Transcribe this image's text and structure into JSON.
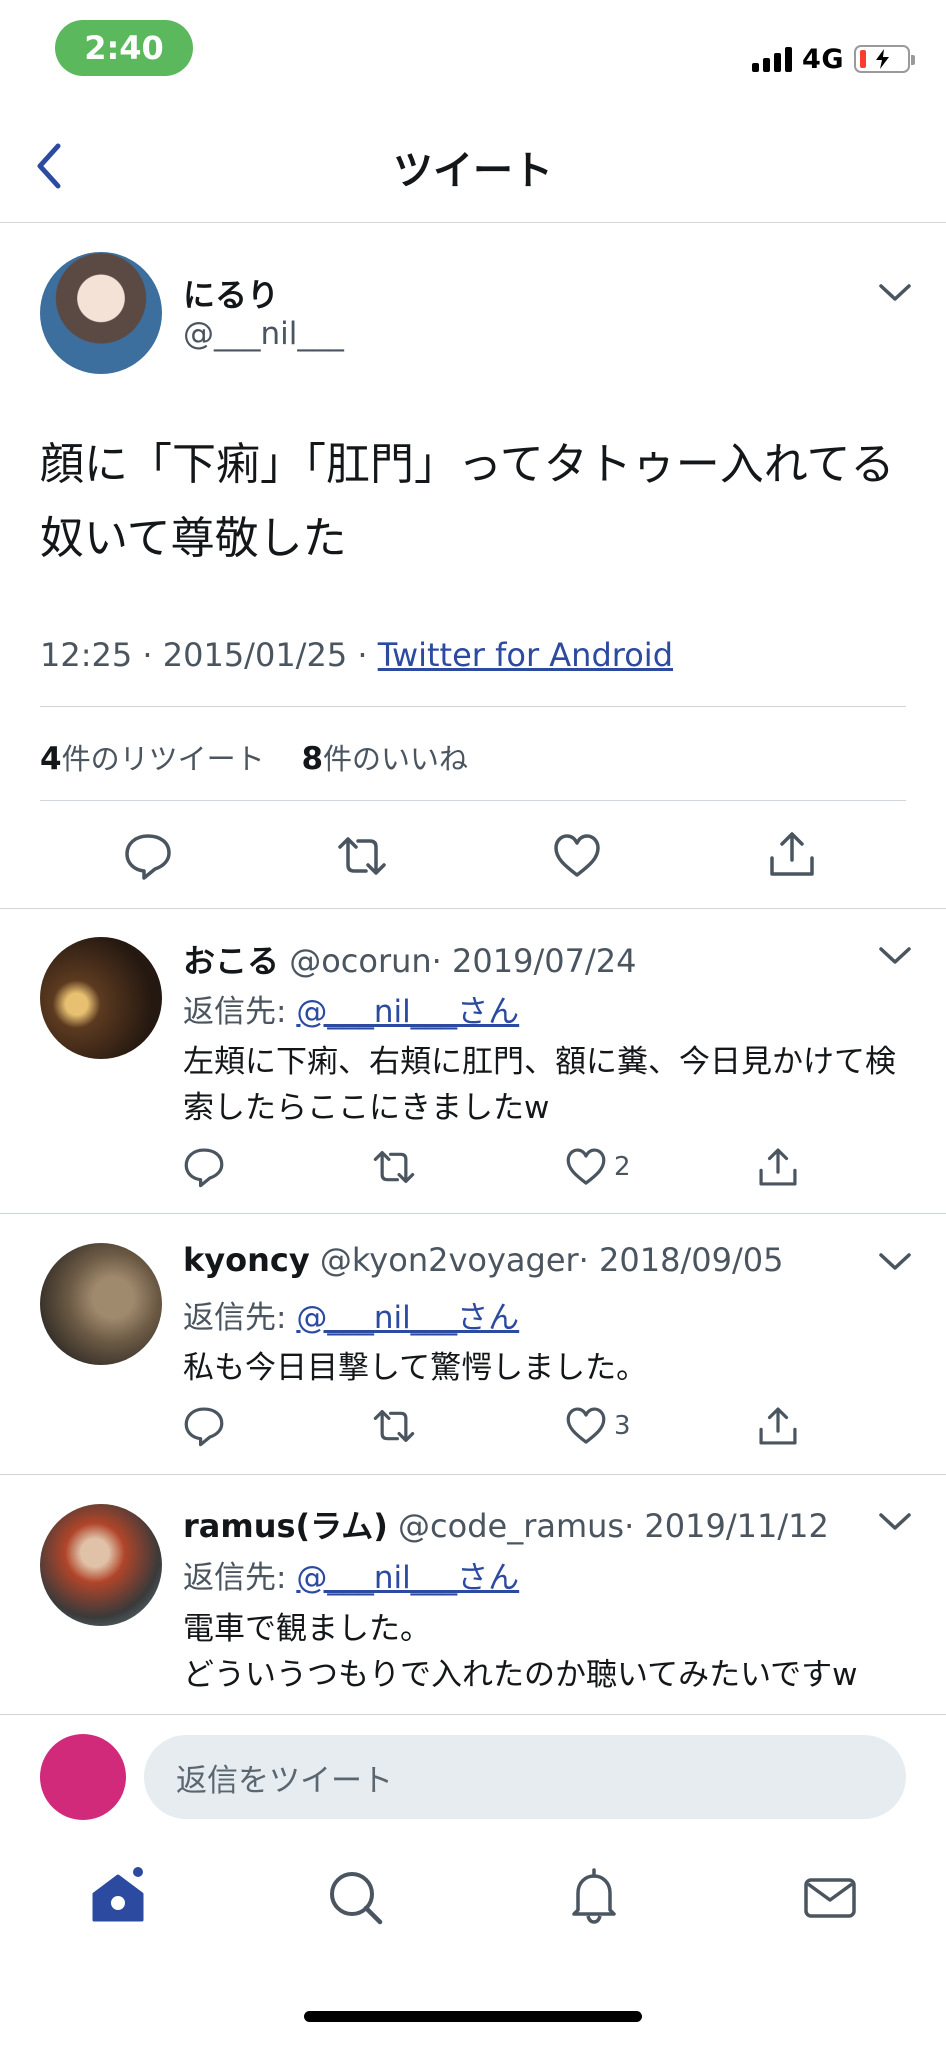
{
  "status": {
    "time": "2:40",
    "network": "4G"
  },
  "header": {
    "title": "ツイート"
  },
  "tweet": {
    "name": "にるり",
    "handle": "@___nil___",
    "text": "顔に「下痢」「肛門」ってタトゥー入れてる奴いて尊敬した",
    "meta": "12:25 · 2015/01/25 · ",
    "source": "Twitter for Android",
    "retweet_count": "4",
    "retweet_label": "件のリツイート",
    "like_count": "8",
    "like_label": "件のいいね"
  },
  "replies": [
    {
      "name": "おこる",
      "handle": "@ocorun",
      "date": "· 2019/07/24",
      "reply_label": "返信先: ",
      "reply_to": "@___nil___さん",
      "text": "左頬に下痢、右頬に肛門、額に糞、今日見かけて検索したらここにきましたw",
      "likes": "2"
    },
    {
      "name": "kyoncy",
      "handle": "@kyon2voyager",
      "date": "· 2018/09/05",
      "reply_label": "返信先: ",
      "reply_to": "@___nil___さん",
      "text": "私も今日目撃して驚愕しました。",
      "likes": "3"
    },
    {
      "name": "ramus(ラム)",
      "handle": "@code_ramus",
      "date": "· 2019/11/12",
      "reply_label": "返信先: ",
      "reply_to": "@___nil___さん",
      "text": "電車で観ました。\nどういうつもりで入れたのか聴いてみたいですw"
    }
  ],
  "composer": {
    "placeholder": "返信をツイート"
  },
  "colors": {
    "accent": "#2b4aa0",
    "status_pill": "#5bb85c",
    "composer_avatar": "#d12a7a"
  },
  "icons": [
    "back-icon",
    "chevron-down-icon",
    "reply-icon",
    "retweet-icon",
    "like-icon",
    "share-icon",
    "home-icon",
    "search-icon",
    "notifications-icon",
    "messages-icon"
  ]
}
